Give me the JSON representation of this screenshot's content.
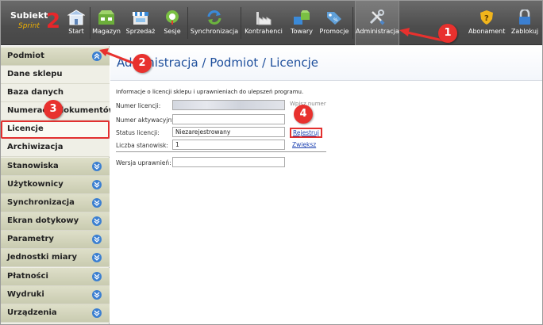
{
  "logo": {
    "brand": "Subiekt",
    "product": "Sprint",
    "version": "2"
  },
  "toolbar": {
    "items": [
      {
        "id": "start",
        "label": "Start",
        "icon": "store-icon"
      },
      {
        "id": "magazyn",
        "label": "Magazyn",
        "icon": "warehouse-icon"
      },
      {
        "id": "sprzedaz",
        "label": "Sprzedaż",
        "icon": "shop-icon"
      },
      {
        "id": "sesje",
        "label": "Sesje",
        "icon": "session-icon"
      },
      {
        "id": "synchronizacja",
        "label": "Synchronizacja",
        "icon": "sync-icon"
      },
      {
        "id": "kontrahenci",
        "label": "Kontrahenci",
        "icon": "factory-icon"
      },
      {
        "id": "towary",
        "label": "Towary",
        "icon": "goods-icon"
      },
      {
        "id": "promocje",
        "label": "Promocje",
        "icon": "tag-icon"
      },
      {
        "id": "administracja",
        "label": "Administracja",
        "icon": "tools-icon"
      },
      {
        "id": "abonament",
        "label": "Abonament",
        "icon": "shield-icon"
      },
      {
        "id": "zablokuj",
        "label": "Zablokuj",
        "icon": "lock-icon"
      }
    ]
  },
  "sidebar": {
    "items": [
      {
        "label": "Podmiot",
        "type": "head",
        "expanded": true
      },
      {
        "label": "Dane sklepu",
        "type": "sub"
      },
      {
        "label": "Baza danych",
        "type": "sub"
      },
      {
        "label": "Numeracja dokumentów",
        "type": "sub"
      },
      {
        "label": "Licencje",
        "type": "sub",
        "selected": true
      },
      {
        "label": "Archiwizacja",
        "type": "sub"
      },
      {
        "label": "Stanowiska",
        "type": "head"
      },
      {
        "label": "Użytkownicy",
        "type": "head"
      },
      {
        "label": "Synchronizacja",
        "type": "head"
      },
      {
        "label": "Ekran dotykowy",
        "type": "head"
      },
      {
        "label": "Parametry",
        "type": "head"
      },
      {
        "label": "Jednostki miary",
        "type": "head"
      },
      {
        "label": "Płatności",
        "type": "head"
      },
      {
        "label": "Wydruki",
        "type": "head"
      },
      {
        "label": "Urządzenia",
        "type": "head"
      }
    ]
  },
  "main": {
    "title": "Administracja / Podmiot / Licencje",
    "info": "Informacje o licencji sklepu i uprawnieniach do ulepszeń programu.",
    "fields": {
      "license_number_label": "Numer licencji:",
      "license_number_value": "",
      "activation_number_label": "Numer aktywacyjny:",
      "activation_number_value": "",
      "status_label": "Status licencji:",
      "status_value": "Niezarejestrowany",
      "workstations_label": "Liczba stanowisk:",
      "workstations_value": "1",
      "version_rights_label": "Wersja uprawnień:",
      "version_rights_value": ""
    },
    "wpisz_label": "Wpisz numer",
    "register_link": "Rejestruj",
    "increase_link": "Zwiększ"
  },
  "annotations": [
    "1",
    "2",
    "3",
    "4"
  ],
  "colors": {
    "accent": "#e8312e",
    "title": "#1e4f9c",
    "link": "#1a3fb0"
  }
}
